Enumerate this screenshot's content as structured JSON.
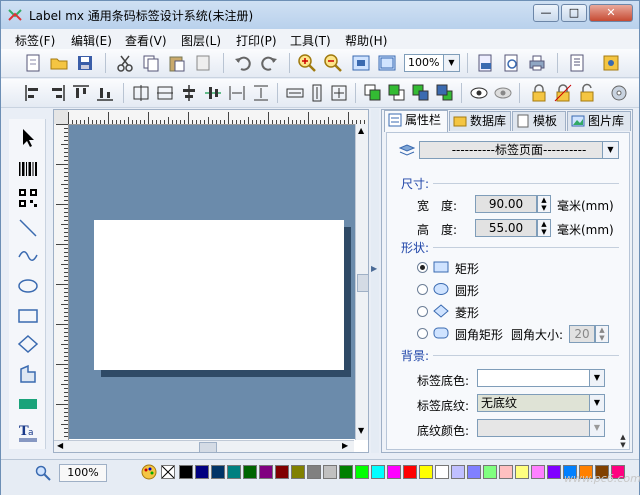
{
  "window": {
    "title": "Label mx 通用条码标签设计系统(未注册)",
    "min_label": "—",
    "max_label": "□",
    "close_label": "✕"
  },
  "menu": [
    "标签(F)",
    "编辑(E)",
    "查看(V)",
    "图层(L)",
    "打印(P)",
    "工具(T)",
    "帮助(H)"
  ],
  "toolbar": {
    "zoom_value": "100%"
  },
  "tabs": [
    "属性栏",
    "数据库",
    "模板",
    "图片库"
  ],
  "properties": {
    "object_select": "----------标签页面----------",
    "size_group": "尺寸:",
    "width_label": "宽　度:",
    "width_value": "90.00",
    "height_label": "高　度:",
    "height_value": "55.00",
    "unit": "毫米(mm)",
    "shape_group": "形状:",
    "shapes": [
      "矩形",
      "圆形",
      "菱形",
      "圆角矩形"
    ],
    "corner_label": "圆角大小:",
    "corner_value": "20",
    "background_group": "背景:",
    "bg_color_label": "标签底色:",
    "bg_pattern_label": "标签底纹:",
    "bg_pattern_value": "无底纹",
    "pattern_color_label": "底纹颜色:"
  },
  "status": {
    "zoom": "100%"
  },
  "palette": [
    "#000000",
    "#000080",
    "#003366",
    "#008080",
    "#006400",
    "#800080",
    "#800000",
    "#808000",
    "#808080",
    "#c0c0c0",
    "#008000",
    "#00ff00",
    "#00ffff",
    "#ff00ff",
    "#ff0000",
    "#ffff00",
    "#ffffff",
    "#c0c0ff",
    "#8080ff",
    "#80ff80",
    "#ffc0c0",
    "#ffff80",
    "#ff80ff",
    "#8000ff",
    "#0080ff",
    "#ff8000",
    "#804000",
    "#ff0080"
  ],
  "watermark": "www.pc6.com"
}
